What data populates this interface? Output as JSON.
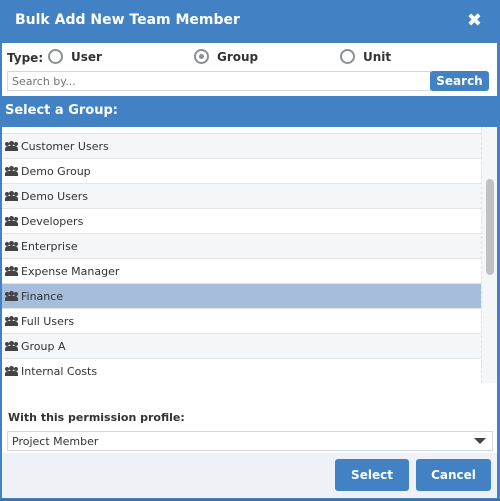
{
  "dialog": {
    "title": "Bulk Add New Team Member",
    "close_icon": "close-icon"
  },
  "type": {
    "label": "Type:",
    "options": [
      {
        "label": "User",
        "selected": false
      },
      {
        "label": "Group",
        "selected": true
      },
      {
        "label": "Unit",
        "selected": false
      }
    ]
  },
  "search": {
    "placeholder": "Search by...",
    "value": "",
    "button": "Search"
  },
  "groups": {
    "header": "Select a Group:",
    "items": [
      "Customer Users",
      "Demo Group",
      "Demo Users",
      "Developers",
      "Enterprise",
      "Expense Manager",
      "Finance",
      "Full Users",
      "Group A",
      "Internal Costs"
    ],
    "selected": "Finance",
    "item_icon": "users-icon"
  },
  "permission": {
    "label": "With this permission profile:",
    "value": "Project Member"
  },
  "footer": {
    "select": "Select",
    "cancel": "Cancel"
  },
  "colors": {
    "accent": "#4282c4",
    "selected_row": "#a6bedb"
  }
}
